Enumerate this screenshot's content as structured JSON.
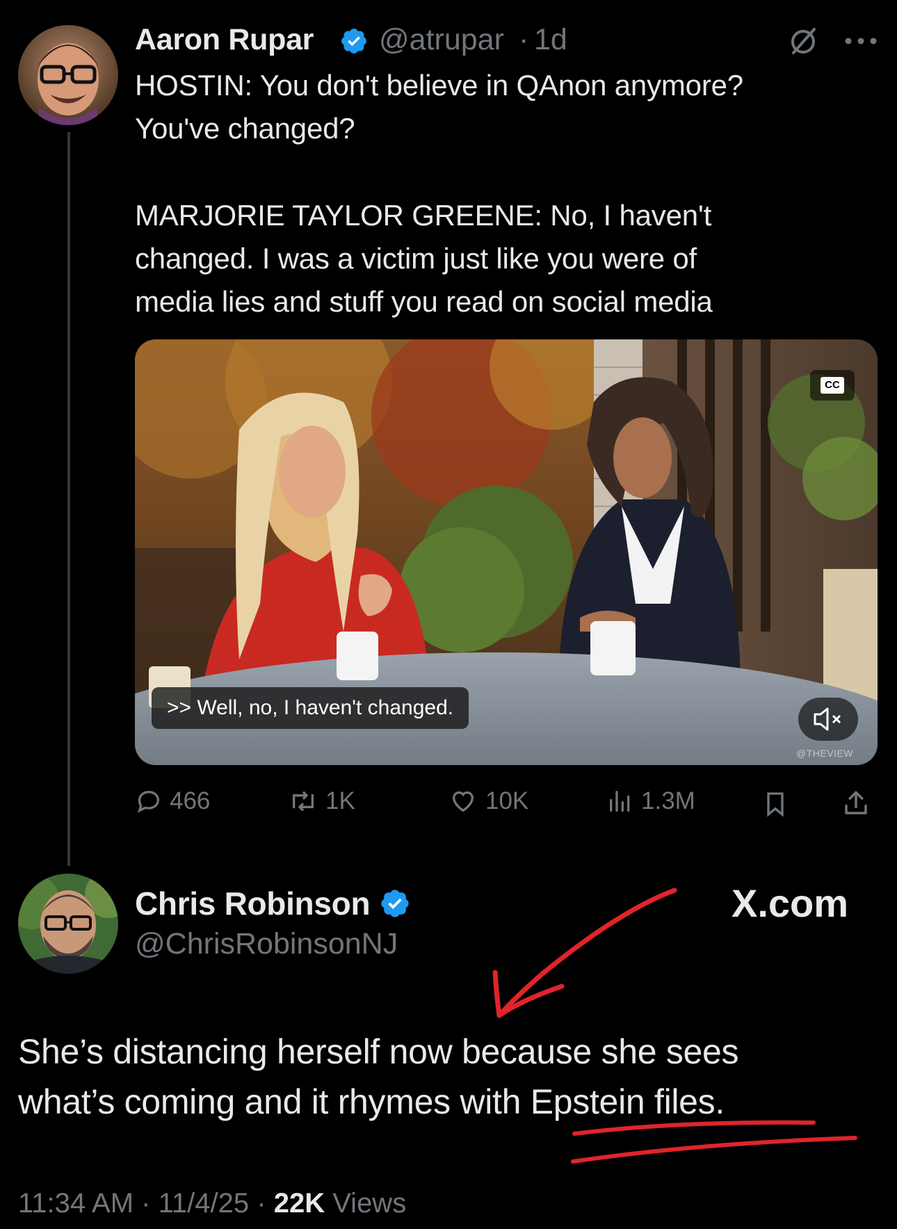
{
  "colors": {
    "background": "#000000",
    "text": "#e7e9ea",
    "muted": "#71767b",
    "verified": "#1d9bf0",
    "annotation": "#e0242b"
  },
  "tweet": {
    "author_name": "Aaron Rupar",
    "author_handle": "@atrupar",
    "separator": "·",
    "time_ago": "1d",
    "grok_icon": "slash-circle-icon",
    "more_icon": "more-dots-icon",
    "text_line_1": "HOSTIN: You don't believe in QAnon anymore?",
    "text_line_2": "You've changed?",
    "text_line_3": "MARJORIE TAYLOR GREENE: No, I haven't",
    "text_line_4": "changed. I was a victim just like you were of",
    "text_line_5": "media lies and stuff you read on social media",
    "media": {
      "caption": ">> Well, no, I haven't changed.",
      "cc_label": "CC",
      "watermark": "@THEVIEW",
      "mute_icon": "speaker-muted-icon"
    },
    "actions": {
      "replies": "466",
      "reposts": "1K",
      "likes": "10K",
      "views": "1.3M",
      "bookmark_icon": "bookmark-icon",
      "share_icon": "share-icon"
    }
  },
  "reply": {
    "author_name": "Chris Robinson",
    "author_handle": "@ChrisRobinsonNJ",
    "watermark": "X.com",
    "text_line_1": "She’s distancing herself now because she sees",
    "text_line_2": "what’s coming and it rhymes with Epstein files.",
    "time": "11:34 AM",
    "date": "11/4/25",
    "views_count": "22K",
    "views_label": "Views",
    "separator": "·"
  }
}
